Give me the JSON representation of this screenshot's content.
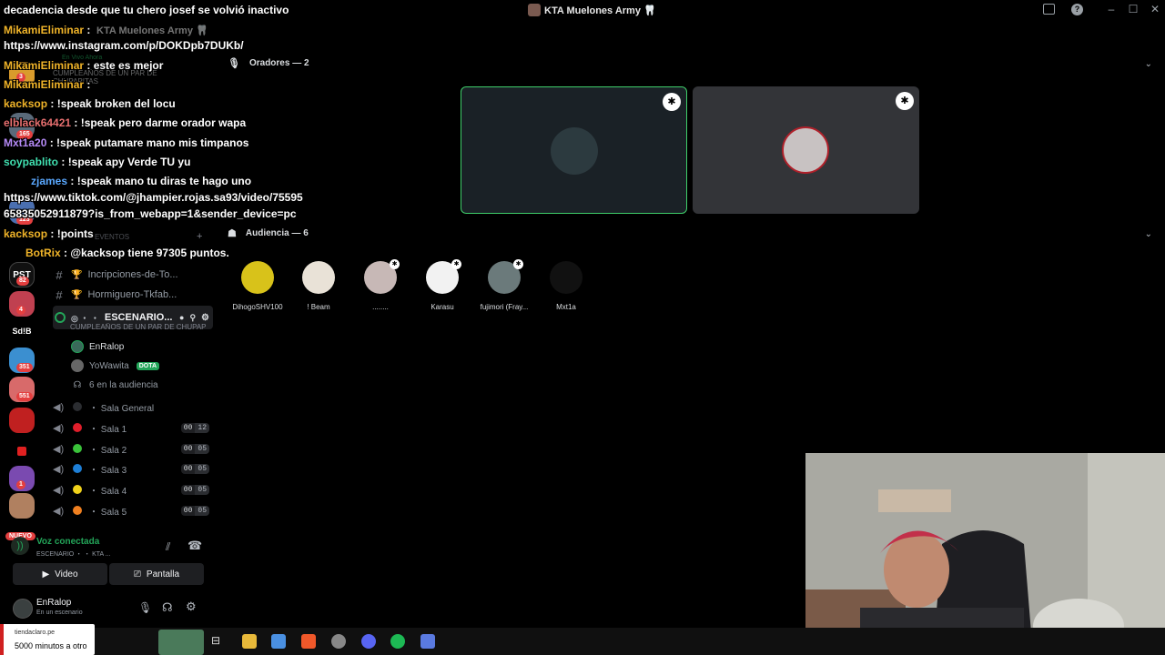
{
  "window": {
    "stream_title": "decadencia desde que tu chero josef se volvió inactivo",
    "server_title": "KTA Muelones Army 🦷",
    "min_icon": "–",
    "max_icon": "☐",
    "close_icon": "✕"
  },
  "rail": {
    "badges": [
      "3",
      "165",
      "123",
      "82",
      "4",
      "351",
      "551",
      "1"
    ],
    "labels": [
      "PST",
      "Sd!B"
    ],
    "nuevo": "NUEVO"
  },
  "sidebar": {
    "server_name": "KTA Muelones Army 🦷",
    "live_notice": "En Vivo Ahora",
    "live_title": "CUMPLEAÑOS DE UN PAR DE CHUPAPITAS",
    "events_label": "EVENTOS",
    "channels": [
      {
        "name": "Incripciones-de-To..."
      },
      {
        "name": "Hormiguero-Tkfab..."
      }
    ],
    "stage": {
      "name": "ESCENARIO...",
      "subtitle": "CUMPLEAÑOS DE UN PAR DE CHUPAPI..."
    },
    "voice_users": [
      {
        "name": "EnRalop",
        "badge": ""
      },
      {
        "name": "YoWawita",
        "badge": "DOTA"
      }
    ],
    "audience_line": "6 en la audiencia",
    "salas": [
      {
        "name": "Sala General",
        "color": "#2b2d31",
        "a": "",
        "b": ""
      },
      {
        "name": "Sala 1",
        "color": "#e01e2b",
        "a": "00",
        "b": "12"
      },
      {
        "name": "Sala 2",
        "color": "#3ac23a",
        "a": "00",
        "b": "05"
      },
      {
        "name": "Sala 3",
        "color": "#1e7fd6",
        "a": "00",
        "b": "05"
      },
      {
        "name": "Sala 4",
        "color": "#f1d21a",
        "a": "00",
        "b": "05"
      },
      {
        "name": "Sala 5",
        "color": "#f08020",
        "a": "00",
        "b": "05"
      }
    ]
  },
  "voice_panel": {
    "status": "Voz conectada",
    "location": "ESCENARIO ・ ・ KTA ...",
    "video_label": "Video",
    "screen_label": "Pantalla"
  },
  "user_panel": {
    "username": "EnRalop",
    "status": "En un escenario"
  },
  "stage": {
    "speakers_header": "Oradores — 2",
    "audience_header": "Audiencia — 6",
    "audience": [
      {
        "name": "DihogoSHV100",
        "color": "#d8c21a",
        "mod": false
      },
      {
        "name": "! Beam",
        "color": "#e9e2d7",
        "mod": false
      },
      {
        "name": "........",
        "color": "#c7b8b6",
        "mod": true
      },
      {
        "name": "Karasu",
        "color": "#f2f2f2",
        "mod": true
      },
      {
        "name": "fujimori (Fray...",
        "color": "#6b7a7b",
        "mod": true
      },
      {
        "name": "Mxt1a",
        "color": "#111111",
        "mod": false
      }
    ]
  },
  "chat": [
    {
      "user": "MikamiEliminar",
      "color": "#f0b429",
      "text": ":"
    },
    {
      "user": "",
      "color": "#ffffff",
      "text": "https://www.instagram.com/p/DOKDpb7DUKb/"
    },
    {
      "user": "MikamiEliminar",
      "color": "#f0b429",
      "text": ": este es mejor"
    },
    {
      "user": "MikamiEliminar",
      "color": "#f0b429",
      "text": ":"
    },
    {
      "user": "kacksop",
      "color": "#f0b429",
      "text": ": !speak broken del locu"
    },
    {
      "user": "elblack64421",
      "color": "#e76f6f",
      "text": ": !speak pero darme orador wapa"
    },
    {
      "user": "Mxt1a20",
      "color": "#b58af7",
      "text": ": !speak putamare mano mis timpanos"
    },
    {
      "user": "soypablito",
      "color": "#40e0b0",
      "text": ": !speak apy Verde TU yu"
    },
    {
      "user": "zjames",
      "color": "#5aa8ff",
      "text": ": !speak mano tu diras te hago uno"
    },
    {
      "user": "",
      "color": "#ffffff",
      "text": "https://www.tiktok.com/@jhampier.rojas.sa93/video/75595"
    },
    {
      "user": "",
      "color": "#ffffff",
      "text": "65835052911879?is_from_webapp=1&sender_device=pc"
    },
    {
      "user": "kacksop",
      "color": "#f0b429",
      "text": ": !points"
    },
    {
      "user": "BotRix",
      "color": "#f0b429",
      "text": ": @kacksop tiene 97305 puntos."
    }
  ],
  "toast": {
    "site": "tiendaclaro.pe",
    "text": "5000 minutos a otro"
  }
}
